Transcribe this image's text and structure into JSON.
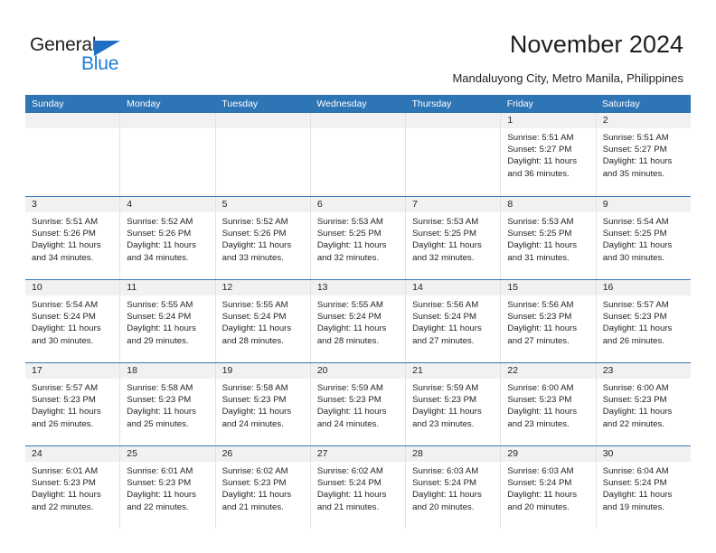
{
  "brand": {
    "name_part1": "General",
    "name_part2": "Blue",
    "triangle_icon": "blue-triangle-logo-mark",
    "accent_color": "#1f7fd4"
  },
  "header": {
    "title": "November 2024",
    "subtitle": "Mandaluyong City, Metro Manila, Philippines"
  },
  "calendar": {
    "header_bg": "#2e75b6",
    "row_divider_color": "#3a78b5",
    "daynum_strip_bg": "#f1f1f1",
    "weekdays": [
      "Sunday",
      "Monday",
      "Tuesday",
      "Wednesday",
      "Thursday",
      "Friday",
      "Saturday"
    ],
    "weeks": [
      [
        {
          "day": "",
          "empty": true
        },
        {
          "day": "",
          "empty": true
        },
        {
          "day": "",
          "empty": true
        },
        {
          "day": "",
          "empty": true
        },
        {
          "day": "",
          "empty": true
        },
        {
          "day": "1",
          "sunrise": "Sunrise: 5:51 AM",
          "sunset": "Sunset: 5:27 PM",
          "daylight": "Daylight: 11 hours and 36 minutes."
        },
        {
          "day": "2",
          "sunrise": "Sunrise: 5:51 AM",
          "sunset": "Sunset: 5:27 PM",
          "daylight": "Daylight: 11 hours and 35 minutes."
        }
      ],
      [
        {
          "day": "3",
          "sunrise": "Sunrise: 5:51 AM",
          "sunset": "Sunset: 5:26 PM",
          "daylight": "Daylight: 11 hours and 34 minutes."
        },
        {
          "day": "4",
          "sunrise": "Sunrise: 5:52 AM",
          "sunset": "Sunset: 5:26 PM",
          "daylight": "Daylight: 11 hours and 34 minutes."
        },
        {
          "day": "5",
          "sunrise": "Sunrise: 5:52 AM",
          "sunset": "Sunset: 5:26 PM",
          "daylight": "Daylight: 11 hours and 33 minutes."
        },
        {
          "day": "6",
          "sunrise": "Sunrise: 5:53 AM",
          "sunset": "Sunset: 5:25 PM",
          "daylight": "Daylight: 11 hours and 32 minutes."
        },
        {
          "day": "7",
          "sunrise": "Sunrise: 5:53 AM",
          "sunset": "Sunset: 5:25 PM",
          "daylight": "Daylight: 11 hours and 32 minutes."
        },
        {
          "day": "8",
          "sunrise": "Sunrise: 5:53 AM",
          "sunset": "Sunset: 5:25 PM",
          "daylight": "Daylight: 11 hours and 31 minutes."
        },
        {
          "day": "9",
          "sunrise": "Sunrise: 5:54 AM",
          "sunset": "Sunset: 5:25 PM",
          "daylight": "Daylight: 11 hours and 30 minutes."
        }
      ],
      [
        {
          "day": "10",
          "sunrise": "Sunrise: 5:54 AM",
          "sunset": "Sunset: 5:24 PM",
          "daylight": "Daylight: 11 hours and 30 minutes."
        },
        {
          "day": "11",
          "sunrise": "Sunrise: 5:55 AM",
          "sunset": "Sunset: 5:24 PM",
          "daylight": "Daylight: 11 hours and 29 minutes."
        },
        {
          "day": "12",
          "sunrise": "Sunrise: 5:55 AM",
          "sunset": "Sunset: 5:24 PM",
          "daylight": "Daylight: 11 hours and 28 minutes."
        },
        {
          "day": "13",
          "sunrise": "Sunrise: 5:55 AM",
          "sunset": "Sunset: 5:24 PM",
          "daylight": "Daylight: 11 hours and 28 minutes."
        },
        {
          "day": "14",
          "sunrise": "Sunrise: 5:56 AM",
          "sunset": "Sunset: 5:24 PM",
          "daylight": "Daylight: 11 hours and 27 minutes."
        },
        {
          "day": "15",
          "sunrise": "Sunrise: 5:56 AM",
          "sunset": "Sunset: 5:23 PM",
          "daylight": "Daylight: 11 hours and 27 minutes."
        },
        {
          "day": "16",
          "sunrise": "Sunrise: 5:57 AM",
          "sunset": "Sunset: 5:23 PM",
          "daylight": "Daylight: 11 hours and 26 minutes."
        }
      ],
      [
        {
          "day": "17",
          "sunrise": "Sunrise: 5:57 AM",
          "sunset": "Sunset: 5:23 PM",
          "daylight": "Daylight: 11 hours and 26 minutes."
        },
        {
          "day": "18",
          "sunrise": "Sunrise: 5:58 AM",
          "sunset": "Sunset: 5:23 PM",
          "daylight": "Daylight: 11 hours and 25 minutes."
        },
        {
          "day": "19",
          "sunrise": "Sunrise: 5:58 AM",
          "sunset": "Sunset: 5:23 PM",
          "daylight": "Daylight: 11 hours and 24 minutes."
        },
        {
          "day": "20",
          "sunrise": "Sunrise: 5:59 AM",
          "sunset": "Sunset: 5:23 PM",
          "daylight": "Daylight: 11 hours and 24 minutes."
        },
        {
          "day": "21",
          "sunrise": "Sunrise: 5:59 AM",
          "sunset": "Sunset: 5:23 PM",
          "daylight": "Daylight: 11 hours and 23 minutes."
        },
        {
          "day": "22",
          "sunrise": "Sunrise: 6:00 AM",
          "sunset": "Sunset: 5:23 PM",
          "daylight": "Daylight: 11 hours and 23 minutes."
        },
        {
          "day": "23",
          "sunrise": "Sunrise: 6:00 AM",
          "sunset": "Sunset: 5:23 PM",
          "daylight": "Daylight: 11 hours and 22 minutes."
        }
      ],
      [
        {
          "day": "24",
          "sunrise": "Sunrise: 6:01 AM",
          "sunset": "Sunset: 5:23 PM",
          "daylight": "Daylight: 11 hours and 22 minutes."
        },
        {
          "day": "25",
          "sunrise": "Sunrise: 6:01 AM",
          "sunset": "Sunset: 5:23 PM",
          "daylight": "Daylight: 11 hours and 22 minutes."
        },
        {
          "day": "26",
          "sunrise": "Sunrise: 6:02 AM",
          "sunset": "Sunset: 5:23 PM",
          "daylight": "Daylight: 11 hours and 21 minutes."
        },
        {
          "day": "27",
          "sunrise": "Sunrise: 6:02 AM",
          "sunset": "Sunset: 5:24 PM",
          "daylight": "Daylight: 11 hours and 21 minutes."
        },
        {
          "day": "28",
          "sunrise": "Sunrise: 6:03 AM",
          "sunset": "Sunset: 5:24 PM",
          "daylight": "Daylight: 11 hours and 20 minutes."
        },
        {
          "day": "29",
          "sunrise": "Sunrise: 6:03 AM",
          "sunset": "Sunset: 5:24 PM",
          "daylight": "Daylight: 11 hours and 20 minutes."
        },
        {
          "day": "30",
          "sunrise": "Sunrise: 6:04 AM",
          "sunset": "Sunset: 5:24 PM",
          "daylight": "Daylight: 11 hours and 19 minutes."
        }
      ]
    ]
  }
}
